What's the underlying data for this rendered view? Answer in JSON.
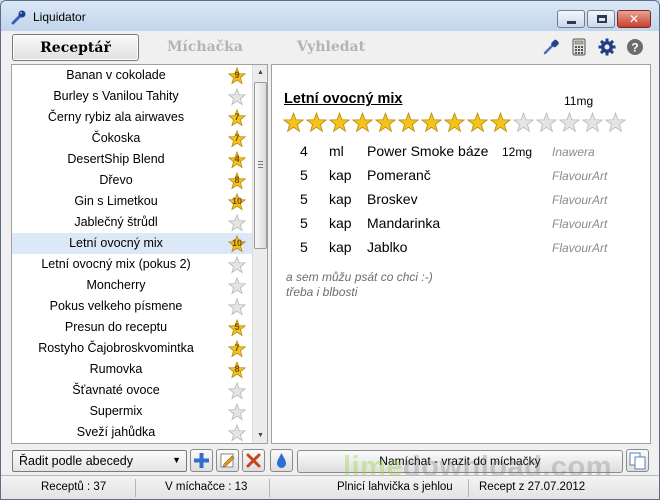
{
  "window": {
    "title": "Liquidator"
  },
  "tabs": [
    "Receptář",
    "Míchačka",
    "Vyhledat"
  ],
  "toolbar_icons": [
    "pipette-icon",
    "calculator-icon",
    "settings-gear-icon",
    "help-icon"
  ],
  "recipes": [
    {
      "name": "Banan v cokolade",
      "rating": 9,
      "starred": true
    },
    {
      "name": "Burley s Vanilou Tahity",
      "rating": null,
      "starred": false
    },
    {
      "name": "Černy rybiz ala airwaves",
      "rating": 7,
      "starred": true
    },
    {
      "name": "Čokoska",
      "rating": 7,
      "starred": true
    },
    {
      "name": "DesertShip Blend",
      "rating": 4,
      "starred": true
    },
    {
      "name": "Dřevo",
      "rating": 8,
      "starred": true
    },
    {
      "name": "Gin s Limetkou",
      "rating": 10,
      "starred": true
    },
    {
      "name": "Jablečný štrůdl",
      "rating": null,
      "starred": false
    },
    {
      "name": "Letní ovocný mix",
      "rating": 10,
      "starred": true,
      "selected": true
    },
    {
      "name": "Letní ovocný mix (pokus 2)",
      "rating": null,
      "starred": false
    },
    {
      "name": "Moncherry",
      "rating": null,
      "starred": false
    },
    {
      "name": "Pokus velkeho písmene",
      "rating": null,
      "starred": false
    },
    {
      "name": "Presun do receptu",
      "rating": 5,
      "starred": true
    },
    {
      "name": "Rostyho Čajobroskvomintka",
      "rating": 7,
      "starred": true
    },
    {
      "name": "Rumovka",
      "rating": 8,
      "starred": true
    },
    {
      "name": "Šťavnaté ovoce",
      "rating": null,
      "starred": false
    },
    {
      "name": "Supermix",
      "rating": null,
      "starred": false
    },
    {
      "name": "Sveží jahůdka",
      "rating": null,
      "starred": false
    }
  ],
  "detail": {
    "title": "Letní ovocný mix",
    "strength": "11mg",
    "rating": 10,
    "rating_max": 15,
    "ingredients": [
      {
        "amount": "4",
        "unit": "ml",
        "name": "Power Smoke báze",
        "strength": "12mg",
        "brand": "Inawera"
      },
      {
        "amount": "5",
        "unit": "kap",
        "name": "Pomeranč",
        "strength": "",
        "brand": "FlavourArt"
      },
      {
        "amount": "5",
        "unit": "kap",
        "name": "Broskev",
        "strength": "",
        "brand": "FlavourArt"
      },
      {
        "amount": "5",
        "unit": "kap",
        "name": "Mandarinka",
        "strength": "",
        "brand": "FlavourArt"
      },
      {
        "amount": "5",
        "unit": "kap",
        "name": "Jablko",
        "strength": "",
        "brand": "FlavourArt"
      }
    ],
    "notes": [
      "a sem můžu psát co chci :-)",
      "třeba i blbosti"
    ]
  },
  "controls": {
    "sort_label": "Řadit podle abecedy",
    "mix_button": "Namíchat - vrazit do míchačky"
  },
  "status": {
    "recipes_count": "Receptů : 37",
    "in_mixer": "V míchačce : 13",
    "bottle": "Plnicí lahvička s jehlou",
    "recipe_date": "Recept z 27.07.2012"
  },
  "watermark": {
    "brand": "lime",
    "domain": "download.com"
  },
  "colors": {
    "star_gold": "#f3c21b",
    "star_empty": "#e4e4e4",
    "selection": "#dde8f7",
    "brand_gray": "#8a8a8a"
  }
}
